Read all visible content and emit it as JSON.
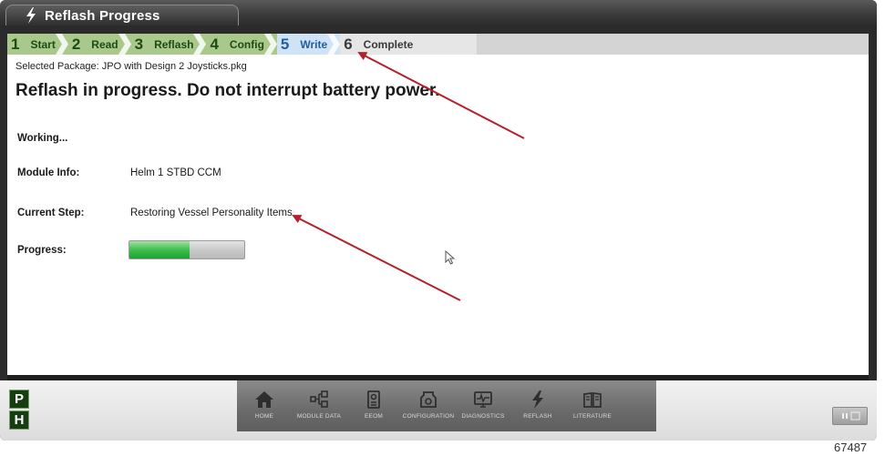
{
  "window": {
    "title": "Reflash Progress"
  },
  "steps": [
    {
      "num": "1",
      "label": "Start",
      "state": "done"
    },
    {
      "num": "2",
      "label": "Read",
      "state": "done"
    },
    {
      "num": "3",
      "label": "Reflash",
      "state": "done"
    },
    {
      "num": "4",
      "label": "Config",
      "state": "done"
    },
    {
      "num": "5",
      "label": "Write",
      "state": "active"
    },
    {
      "num": "6",
      "label": "Complete",
      "state": "todo"
    }
  ],
  "package": {
    "text": "Selected Package: JPO with Design 2 Joysticks.pkg"
  },
  "headline": "Reflash in progress. Do not interrupt battery power.",
  "status": {
    "working": "Working..."
  },
  "module": {
    "label": "Module Info:",
    "value": "Helm 1 STBD CCM"
  },
  "current_step": {
    "label": "Current Step:",
    "value": "Restoring Vessel Personality Items"
  },
  "progress": {
    "label": "Progress:",
    "fraction": 0.52
  },
  "side_buttons": {
    "p": "P",
    "h": "H"
  },
  "nav": [
    {
      "label": "HOME",
      "icon": "home-icon"
    },
    {
      "label": "MODULE DATA",
      "icon": "module-data-icon"
    },
    {
      "label": "EEOM",
      "icon": "eeom-icon"
    },
    {
      "label": "CONFIGURATION",
      "icon": "configuration-icon"
    },
    {
      "label": "DIAGNOSTICS",
      "icon": "diagnostics-icon"
    },
    {
      "label": "REFLASH",
      "icon": "reflash-icon"
    },
    {
      "label": "LITERATURE",
      "icon": "literature-icon"
    }
  ],
  "right_button": {
    "icon": "pause-icon"
  },
  "figure_number": "67487",
  "colors": {
    "step_done": "#a9c98c",
    "step_active": "#cfe2f6",
    "progress_fill": "#3fbf4f",
    "arrow": "#b3202a"
  }
}
